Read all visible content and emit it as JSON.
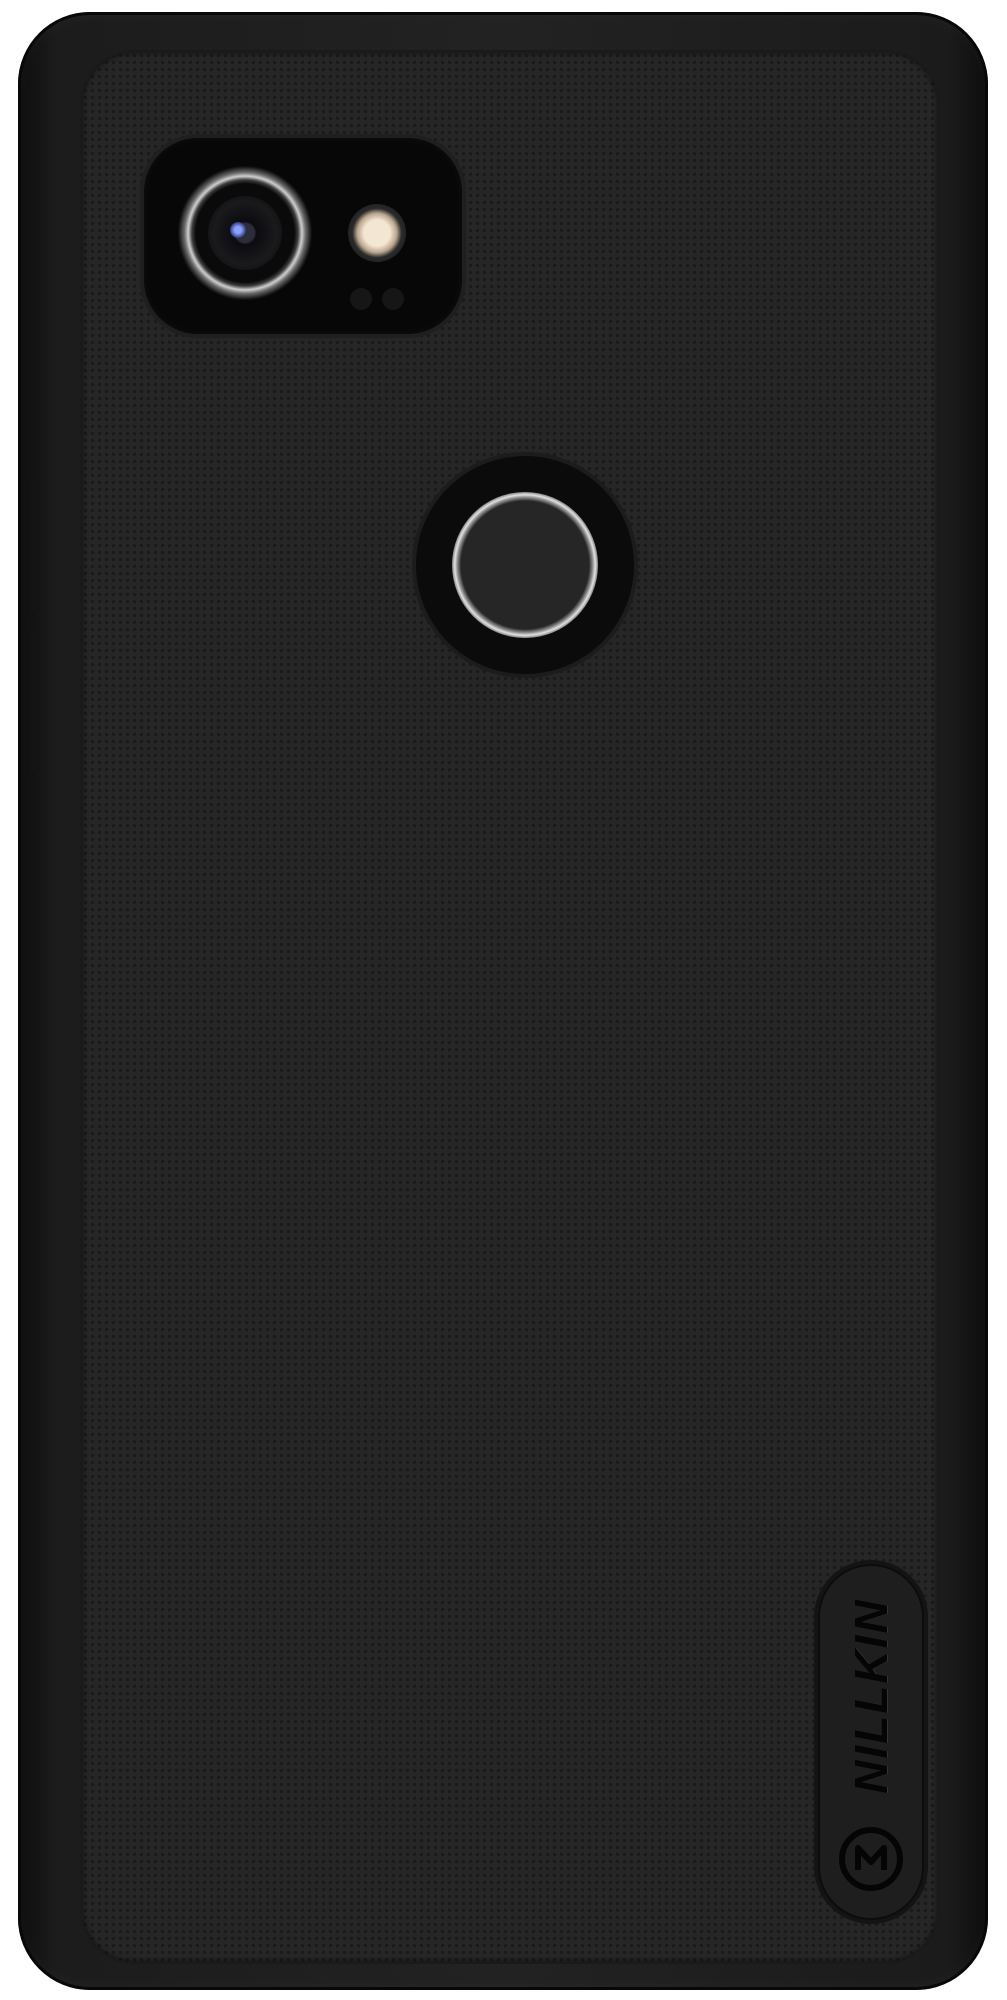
{
  "product": {
    "brand_logo_text": "NILLKIN",
    "colors": {
      "case": "#222222",
      "texture_dots": "#1a1a1a",
      "camera_module": "#070707",
      "flash": "#f3e6d2",
      "fingerprint_ring": "#e2e2e2",
      "background": "#ffffff"
    },
    "icons": [
      "camera-lens-icon",
      "flash-icon",
      "fingerprint-sensor-icon",
      "nillkin-emblem-icon"
    ]
  }
}
